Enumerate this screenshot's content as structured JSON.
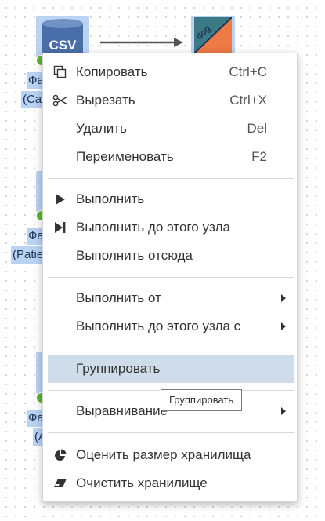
{
  "canvas": {
    "nodes": [
      {
        "icon": "csv-file-icon",
        "icon_text": "CSV",
        "label_line1": "Фа",
        "label_line2": "(Ca"
      },
      {
        "icon": "csv-file-icon",
        "icon_text": "",
        "label_line1": "Фа",
        "label_line2": "(Patie"
      },
      {
        "icon": "csv-file-icon",
        "icon_text": "",
        "label_line1": "Фа",
        "label_line2": "(A"
      }
    ],
    "target_node": {
      "icon": "dog-split-node-icon",
      "icon_text": "dog"
    },
    "status_color": "#5cb531",
    "selection_color": "#b9d3f3"
  },
  "context_menu": {
    "items": [
      {
        "id": "copy",
        "icon": "copy-icon",
        "label": "Копировать",
        "shortcut": "Ctrl+C"
      },
      {
        "id": "cut",
        "icon": "scissors-icon",
        "label": "Вырезать",
        "shortcut": "Ctrl+X"
      },
      {
        "id": "delete",
        "icon": "",
        "label": "Удалить",
        "shortcut": "Del"
      },
      {
        "id": "rename",
        "icon": "",
        "label": "Переименовать",
        "shortcut": "F2"
      },
      {
        "id": "run",
        "icon": "play-icon",
        "label": "Выполнить",
        "shortcut": ""
      },
      {
        "id": "run-to-node",
        "icon": "play-to-bar-icon",
        "label": "Выполнить до этого узла",
        "shortcut": ""
      },
      {
        "id": "run-from-here",
        "icon": "",
        "label": "Выполнить отсюда",
        "shortcut": ""
      },
      {
        "id": "run-from",
        "icon": "",
        "label": "Выполнить от",
        "shortcut": "",
        "submenu": true
      },
      {
        "id": "run-to-node-with",
        "icon": "",
        "label": "Выполнить до этого узла с",
        "shortcut": "",
        "submenu": true
      },
      {
        "id": "group",
        "icon": "",
        "label": "Группировать",
        "shortcut": "",
        "highlighted": true
      },
      {
        "id": "align",
        "icon": "",
        "label": "Выравнивание",
        "shortcut": "",
        "submenu": true
      },
      {
        "id": "estimate-storage",
        "icon": "pie-chart-icon",
        "label": "Оценить размер хранилища",
        "shortcut": ""
      },
      {
        "id": "clear-storage",
        "icon": "eraser-icon",
        "label": "Очистить хранилище",
        "shortcut": ""
      }
    ],
    "highlight_color": "#cfdcea"
  },
  "tooltip": {
    "text": "Группировать"
  }
}
